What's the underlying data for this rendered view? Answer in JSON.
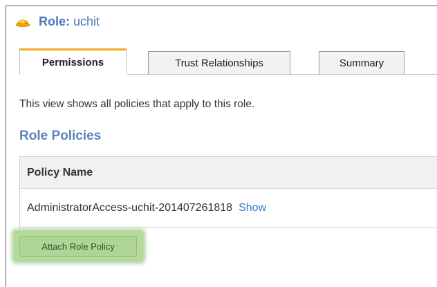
{
  "role": {
    "icon": "hard-hat-icon",
    "title_prefix": "Role:",
    "title_name": " uchit"
  },
  "tabs": [
    {
      "label": "Permissions",
      "active": true
    },
    {
      "label": "Trust Relationships",
      "active": false
    },
    {
      "label": "Summary",
      "active": false
    }
  ],
  "description": "This view shows all policies that apply to this role.",
  "section_title": "Role Policies",
  "policy_table": {
    "header": "Policy Name",
    "rows": [
      {
        "name": "AdministratorAccess-uchit-201407261818",
        "action": "Show"
      }
    ]
  },
  "attach_button_label": "Attach Role Policy",
  "colors": {
    "accent_blue": "#4a7ab4",
    "active_tab_top": "#f0a81c",
    "highlight_green": "#b4d99a"
  }
}
